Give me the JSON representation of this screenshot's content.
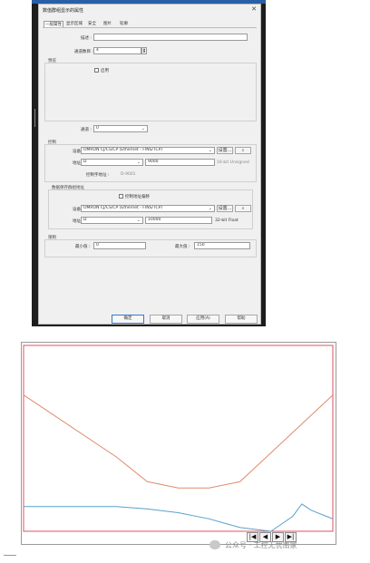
{
  "dialog": {
    "title": "数值群组显示的属性",
    "tabs": [
      "一般属性",
      "显示区域",
      "安全",
      "图片",
      "轮廓"
    ],
    "desc_label": "描述 :",
    "desc_value": "",
    "channels_label": "通道数目 :",
    "channels_value": "4",
    "preview_label": "预览",
    "enable_label": "启用",
    "channel_label": "通道 :",
    "channel_value": "0",
    "control_label": "控制",
    "device_label": "设备 :",
    "device_value": "OMRON CJ/CS/CP (Ethernet - FINS/TCP)",
    "settings_btn": "设置...",
    "addr_label": "地址 :",
    "addr_value": "D",
    "addr_num": "9000",
    "addr_type": "16-bit Unsigned",
    "control_addr_label": "控制字地址 :",
    "control_addr_value": "D-9001",
    "data_group_label": "数据保存群组地址",
    "use_offset_label": "控制地址偏移",
    "device2_value": "OMRON CJ/CS/CP (Ethernet - FINS/TCP)",
    "addr2_value": "D",
    "addr2_num": "10000",
    "addr2_type": "32-bit Float",
    "limit_label": "限制",
    "min_label": "最小值 :",
    "min_value": "0",
    "max_label": "最大值 :",
    "max_value": "150",
    "buttons": {
      "ok": "确定",
      "cancel": "取消",
      "apply": "应用(A)",
      "help": "帮助"
    }
  },
  "chart_data": {
    "type": "line",
    "title": "",
    "xlabel": "",
    "ylabel": "",
    "grid": false,
    "xlim": [
      0,
      10
    ],
    "ylim": [
      0,
      150
    ],
    "series": [
      {
        "color": "#e08a6a",
        "x": [
          0,
          3,
          4,
          5,
          6,
          7,
          10
        ],
        "y": [
          110,
          60,
          40,
          35,
          35,
          40,
          110
        ]
      },
      {
        "color": "#5aa1c8",
        "x": [
          0,
          3,
          4,
          5,
          6,
          7,
          8,
          8.7,
          9,
          9.3,
          9.8,
          10
        ],
        "y": [
          20,
          20,
          18,
          15,
          10,
          3,
          0,
          12,
          22,
          17,
          12,
          10
        ]
      }
    ],
    "limit_lines_color": "#e05060"
  },
  "nav": {
    "first": "|◀",
    "prev": "◀",
    "next": "▶",
    "last": "▶|"
  },
  "watermark": "公众号 · 工控无忧南家",
  "colors": {
    "accent": "#2a5fa8",
    "limit": "#e05060",
    "series1": "#e08a6a",
    "series2": "#5aa1c8"
  }
}
